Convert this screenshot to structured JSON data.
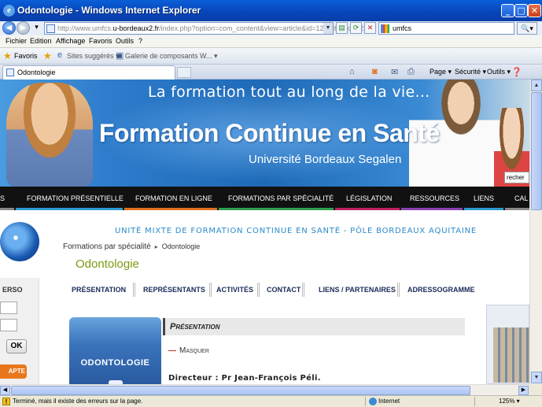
{
  "window": {
    "title": "Odontologie - Windows Internet Explorer",
    "minimize": "_",
    "maximize": "□",
    "close": "✕"
  },
  "address": {
    "url_prefix": "http://www.umfcs.",
    "url_domain": "u-bordeaux2.fr",
    "url_suffix": "/index.php?option=com_content&view=article&id=121&Itemid=122",
    "search_query": "umfcs"
  },
  "menu": [
    "Fichier",
    "Edition",
    "Affichage",
    "Favoris",
    "Outils",
    "?"
  ],
  "favorites": {
    "label": "Favoris",
    "items": [
      "Sites suggérés ▾",
      "Galerie de composants W... ▾"
    ]
  },
  "tab": {
    "label": "Odontologie"
  },
  "commands": [
    "Page ▾",
    "Sécurité ▾",
    "Outils ▾"
  ],
  "banner": {
    "tagline": "La formation tout au long de la vie...",
    "title": "Formation Continue en Santé",
    "university": "Université Bordeaux Segalen",
    "search_stub": "recher"
  },
  "main_nav": [
    {
      "label": "S",
      "color": "#888888"
    },
    {
      "label": "Formation présentielle",
      "color": "#2a9ad0"
    },
    {
      "label": "Formation en ligne",
      "color": "#e07020"
    },
    {
      "label": "Formations par spécialité",
      "color": "#30a050"
    },
    {
      "label": "Législation",
      "color": "#c02060"
    },
    {
      "label": "Ressources",
      "color": "#8a40b0"
    },
    {
      "label": "Liens",
      "color": "#2a9ad0"
    },
    {
      "label": "Cal",
      "color": "#888888"
    }
  ],
  "content": {
    "unit": "UNITÉ MIXTE DE FORMATION CONTINUE EN SANTÉ - PÔLE BORDEAUX AQUITAINE",
    "breadcrumb_parent": "Formations par spécialité",
    "breadcrumb_sep": "▸",
    "breadcrumb_current": "Odontologie",
    "page_title": "Odontologie",
    "subnav": [
      "PRÉSENTATION",
      "REPRÉSENTANTS",
      "ACTIVITÉS",
      "CONTACT",
      "LIENS / PARTENAIRES",
      "ADRESSOGRAMME"
    ],
    "left_panel_label": "ERSO",
    "ok_label": "OK",
    "cta_label": "APTE",
    "logo_text": "ODONTOLOGIE",
    "section_title": "Présentation",
    "masquer_dash": "—",
    "masquer": "Masquer",
    "directeur": "Directeur : Pr Jean-François Péli."
  },
  "status": {
    "message": "Terminé, mais il existe des erreurs sur la page.",
    "zone": "Internet",
    "zoom": "125% ▾"
  }
}
